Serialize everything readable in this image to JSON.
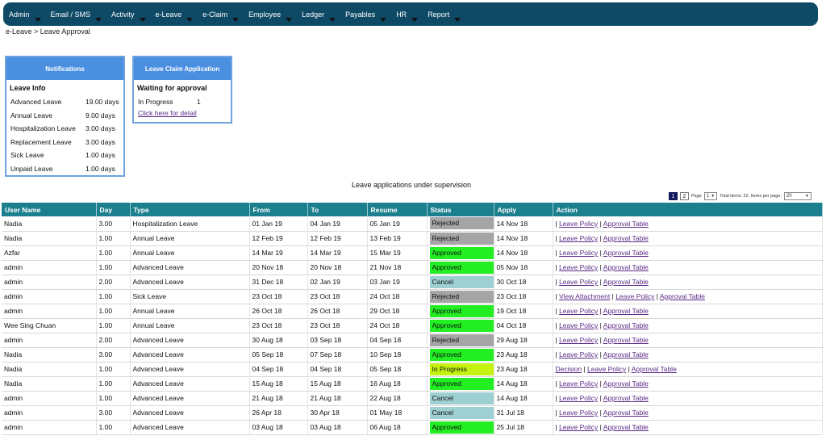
{
  "nav": [
    "Admin",
    "Email / SMS",
    "Activity",
    "e-Leave",
    "e-Claim",
    "Employee",
    "Ledger",
    "Payables",
    "HR",
    "Report"
  ],
  "breadcrumb": "e-Leave > Leave Approval",
  "notifications": {
    "title": "Notifications",
    "subtitle": "Leave Info",
    "rows": [
      {
        "type": "Advanced Leave",
        "value": "19.00 days"
      },
      {
        "type": "Annual Leave",
        "value": "9.00 days"
      },
      {
        "type": "Hospitalization Leave",
        "value": "3.00 days"
      },
      {
        "type": "Replacement Leave",
        "value": "3.00 days"
      },
      {
        "type": "Sick Leave",
        "value": "1.00 days"
      },
      {
        "type": "Unpaid Leave",
        "value": "1.00 days"
      }
    ]
  },
  "claim_card": {
    "title": "Leave Claim Application",
    "subtitle": "Waiting for approval",
    "row_label": "In Progress",
    "row_value": "1",
    "link": "Click here for detail"
  },
  "section_title": "Leave applications under supervision",
  "pager": {
    "pages": [
      "1",
      "2"
    ],
    "page_label": "Page",
    "page_value": "1",
    "summary": "Total items: 22, Items per page:",
    "per_page": "20"
  },
  "columns": [
    "User Name",
    "Day",
    "Type",
    "From",
    "To",
    "Resume",
    "Status",
    "Apply",
    "Action"
  ],
  "status_colors": {
    "Rejected": "#a5a5a5",
    "Approved": "#22ee22",
    "Cancel": "#9dcfd3",
    "In Progress": "#c5f20f"
  },
  "rows": [
    {
      "user": "Nadia",
      "day": "3.00",
      "type": "Hospitalization Leave",
      "from": "01 Jan 19",
      "to": "04 Jan 19",
      "resume": "05 Jan 19",
      "status": "Rejected",
      "apply": "14 Nov 18",
      "actions": [
        "Leave Policy",
        "Approval Table"
      ],
      "lead_sep": true
    },
    {
      "user": "Nadia",
      "day": "1.00",
      "type": "Annual Leave",
      "from": "12 Feb 19",
      "to": "12 Feb 19",
      "resume": "13 Feb 19",
      "status": "Rejected",
      "apply": "14 Nov 18",
      "actions": [
        "Leave Policy",
        "Approval Table"
      ],
      "lead_sep": true
    },
    {
      "user": "Azfar",
      "day": "1.00",
      "type": "Annual Leave",
      "from": "14 Mar 19",
      "to": "14 Mar 19",
      "resume": "15 Mar 19",
      "status": "Approved",
      "apply": "14 Nov 18",
      "actions": [
        "Leave Policy",
        "Approval Table"
      ],
      "lead_sep": true
    },
    {
      "user": "admin",
      "day": "1.00",
      "type": "Advanced Leave",
      "from": "20 Nov 18",
      "to": "20 Nov 18",
      "resume": "21 Nov 18",
      "status": "Approved",
      "apply": "05 Nov 18",
      "actions": [
        "Leave Policy",
        "Approval Table"
      ],
      "lead_sep": true
    },
    {
      "user": "admin",
      "day": "2.00",
      "type": "Advanced Leave",
      "from": "31 Dec 18",
      "to": "02 Jan 19",
      "resume": "03 Jan 19",
      "status": "Cancel",
      "apply": "30 Oct 18",
      "actions": [
        "Leave Policy",
        "Approval Table"
      ],
      "lead_sep": true
    },
    {
      "user": "admin",
      "day": "1.00",
      "type": "Sick Leave",
      "from": "23 Oct 18",
      "to": "23 Oct 18",
      "resume": "24 Oct 18",
      "status": "Rejected",
      "apply": "23 Oct 18",
      "actions": [
        "View Attachment",
        "Leave Policy",
        "Approval Table"
      ],
      "lead_sep": true
    },
    {
      "user": "admin",
      "day": "1.00",
      "type": "Annual Leave",
      "from": "26 Oct 18",
      "to": "26 Oct 18",
      "resume": "29 Oct 18",
      "status": "Approved",
      "apply": "19 Oct 18",
      "actions": [
        "Leave Policy",
        "Approval Table"
      ],
      "lead_sep": true
    },
    {
      "user": "Wee Sing Chuan",
      "day": "1.00",
      "type": "Annual Leave",
      "from": "23 Oct 18",
      "to": "23 Oct 18",
      "resume": "24 Oct 18",
      "status": "Approved",
      "apply": "04 Oct 18",
      "actions": [
        "Leave Policy",
        "Approval Table"
      ],
      "lead_sep": true
    },
    {
      "user": "admin",
      "day": "2.00",
      "type": "Advanced Leave",
      "from": "30 Aug 18",
      "to": "03 Sep 18",
      "resume": "04 Sep 18",
      "status": "Rejected",
      "apply": "29 Aug 18",
      "actions": [
        "Leave Policy",
        "Approval Table"
      ],
      "lead_sep": true
    },
    {
      "user": "Nadia",
      "day": "3.00",
      "type": "Advanced Leave",
      "from": "05 Sep 18",
      "to": "07 Sep 18",
      "resume": "10 Sep 18",
      "status": "Approved",
      "apply": "23 Aug 18",
      "actions": [
        "Leave Policy",
        "Approval Table"
      ],
      "lead_sep": true
    },
    {
      "user": "Nadia",
      "day": "1.00",
      "type": "Advanced Leave",
      "from": "04 Sep 18",
      "to": "04 Sep 18",
      "resume": "05 Sep 18",
      "status": "In Progress",
      "apply": "23 Aug 18",
      "actions": [
        "Decision",
        "Leave Policy",
        "Approval Table"
      ],
      "lead_sep": false
    },
    {
      "user": "Nadia",
      "day": "1.00",
      "type": "Advanced Leave",
      "from": "15 Aug 18",
      "to": "15 Aug 18",
      "resume": "16 Aug 18",
      "status": "Approved",
      "apply": "14 Aug 18",
      "actions": [
        "Leave Policy",
        "Approval Table"
      ],
      "lead_sep": true
    },
    {
      "user": "admin",
      "day": "1.00",
      "type": "Advanced Leave",
      "from": "21 Aug 18",
      "to": "21 Aug 18",
      "resume": "22 Aug 18",
      "status": "Cancel",
      "apply": "14 Aug 18",
      "actions": [
        "Leave Policy",
        "Approval Table"
      ],
      "lead_sep": true
    },
    {
      "user": "admin",
      "day": "3.00",
      "type": "Advanced Leave",
      "from": "26 Apr 18",
      "to": "30 Apr 18",
      "resume": "01 May 18",
      "status": "Cancel",
      "apply": "31 Jul 18",
      "actions": [
        "Leave Policy",
        "Approval Table"
      ],
      "lead_sep": true
    },
    {
      "user": "admin",
      "day": "1.00",
      "type": "Advanced Leave",
      "from": "03 Aug 18",
      "to": "03 Aug 18",
      "resume": "06 Aug 18",
      "status": "Approved",
      "apply": "25 Jul 18",
      "actions": [
        "Leave Policy",
        "Approval Table"
      ],
      "lead_sep": true
    }
  ]
}
